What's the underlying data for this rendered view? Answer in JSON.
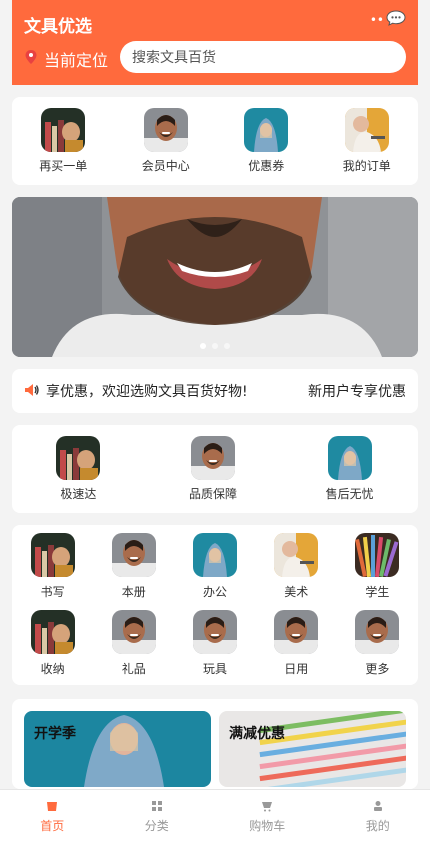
{
  "header": {
    "title": "文具优选",
    "location_label": "当前定位",
    "search_placeholder": "搜索文具百货",
    "location_icon": "pin-icon",
    "chat_icon": "chat-icon"
  },
  "quick_actions": [
    {
      "label": "再买一单",
      "icon": "reorder-icon"
    },
    {
      "label": "会员中心",
      "icon": "member-icon"
    },
    {
      "label": "优惠券",
      "icon": "coupon-icon"
    },
    {
      "label": "我的订单",
      "icon": "orders-icon"
    }
  ],
  "banner": {
    "dots": 3,
    "active_index": 0
  },
  "notice": {
    "icon": "speaker-icon",
    "text": "享优惠，欢迎选购文具百货好物!",
    "right_text": "新用户专享优惠"
  },
  "guarantees": [
    {
      "label": "极速达"
    },
    {
      "label": "品质保障"
    },
    {
      "label": "售后无忧"
    }
  ],
  "categories": [
    {
      "label": "书写"
    },
    {
      "label": "本册"
    },
    {
      "label": "办公"
    },
    {
      "label": "美术"
    },
    {
      "label": "学生"
    },
    {
      "label": "收纳"
    },
    {
      "label": "礼品"
    },
    {
      "label": "玩具"
    },
    {
      "label": "日用"
    },
    {
      "label": "更多"
    }
  ],
  "promos": [
    {
      "title": "开学季"
    },
    {
      "title": "满减优惠"
    }
  ],
  "tabs": [
    {
      "label": "首页",
      "icon": "home-icon",
      "active": true
    },
    {
      "label": "分类",
      "icon": "category-icon",
      "active": false
    },
    {
      "label": "购物车",
      "icon": "cart-icon",
      "active": false
    },
    {
      "label": "我的",
      "icon": "user-icon",
      "active": false
    }
  ],
  "colors": {
    "accent": "#ff6a3d",
    "background": "#f3f3f3",
    "tab_inactive": "#999999"
  }
}
